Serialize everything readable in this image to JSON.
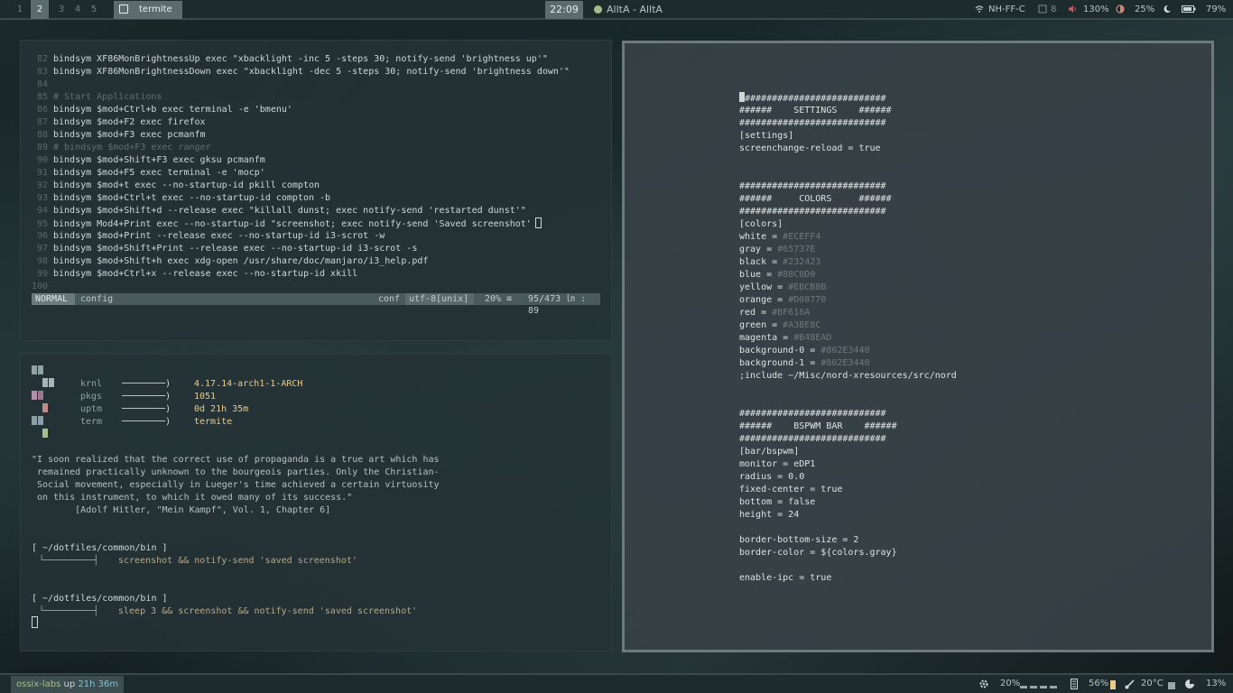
{
  "topbar": {
    "workspaces": [
      "1",
      "2",
      "3",
      "4",
      "5"
    ],
    "active_workspace": "2",
    "window_title": "termite",
    "clock": "22:09",
    "music": "AlltA - AlltA",
    "wifi": "NH-FF-C",
    "disk": "8",
    "volume": "130%",
    "brightness": "25%",
    "night": "",
    "battery": "79%"
  },
  "vim": {
    "lines": [
      {
        "n": "82",
        "t": "bindsym XF86MonBrightnessUp exec \"xbacklight -inc 5 -steps 30; notify-send 'brightness up'\"",
        "kind": "code"
      },
      {
        "n": "83",
        "t": "bindsym XF86MonBrightnessDown exec \"xbacklight -dec 5 -steps 30; notify-send 'brightness down'\"",
        "kind": "code"
      },
      {
        "n": "84",
        "t": "",
        "kind": "code"
      },
      {
        "n": "85",
        "t": "# Start Applications",
        "kind": "comment"
      },
      {
        "n": "86",
        "t": "bindsym $mod+Ctrl+b exec terminal -e 'bmenu'",
        "kind": "code"
      },
      {
        "n": "87",
        "t": "bindsym $mod+F2 exec firefox",
        "kind": "code"
      },
      {
        "n": "88",
        "t": "bindsym $mod+F3 exec pcmanfm",
        "kind": "code"
      },
      {
        "n": "89",
        "t": "# bindsym $mod+F3 exec ranger",
        "kind": "comment"
      },
      {
        "n": "90",
        "t": "bindsym $mod+Shift+F3 exec gksu pcmanfm",
        "kind": "code"
      },
      {
        "n": "91",
        "t": "bindsym $mod+F5 exec terminal -e 'mocp'",
        "kind": "code"
      },
      {
        "n": "92",
        "t": "bindsym $mod+t exec --no-startup-id pkill compton",
        "kind": "code"
      },
      {
        "n": "93",
        "t": "bindsym $mod+Ctrl+t exec --no-startup-id compton -b",
        "kind": "code"
      },
      {
        "n": "94",
        "t": "bindsym $mod+Shift+d --release exec \"killall dunst; exec notify-send 'restarted dunst'\"",
        "kind": "code"
      },
      {
        "n": "95",
        "t": "bindsym Mod4+Print exec --no-startup-id \"screenshot; exec notify-send 'Saved screenshot'",
        "kind": "code"
      },
      {
        "n": "96",
        "t": "bindsym $mod+Print --release exec --no-startup-id i3-scrot -w",
        "kind": "code"
      },
      {
        "n": "97",
        "t": "bindsym $mod+Shift+Print --release exec --no-startup-id i3-scrot -s",
        "kind": "code"
      },
      {
        "n": "98",
        "t": "bindsym $mod+Shift+h exec xdg-open /usr/share/doc/manjaro/i3_help.pdf",
        "kind": "code"
      },
      {
        "n": "99",
        "t": "bindsym $mod+Ctrl+x --release exec --no-startup-id xkill",
        "kind": "code"
      },
      {
        "n": "100",
        "t": "",
        "kind": "code"
      }
    ],
    "status": {
      "mode": "NORMAL",
      "file": "config",
      "filetype": "conf",
      "encoding": "utf-8[unix]",
      "percent": "20% ≡",
      "position": "95/473 ㏑ :  89"
    }
  },
  "neofetch": {
    "rows": [
      {
        "key": "krnl",
        "arrow": "────────)",
        "val": "4.17.14-arch1-1-ARCH"
      },
      {
        "key": "pkgs",
        "arrow": "────────)",
        "val": "1051"
      },
      {
        "key": "uptm",
        "arrow": "────────)",
        "val": "0d 21h 35m"
      },
      {
        "key": "term",
        "arrow": "────────)",
        "val": "termite"
      }
    ],
    "quote": [
      "\"I soon realized that the correct use of propaganda is a true art which has",
      " remained practically unknown to the bourgeois parties. Only the Christian-",
      " Social movement, especially in Lueger's time achieved a certain virtuosity",
      " on this instrument, to which it owed many of its success.\"",
      "        [Adolf Hitler, \"Mein Kampf\", Vol. 1, Chapter 6]"
    ],
    "prompt1_dir": "[ ~/dotfiles/common/bin ]",
    "prompt1_cmd": "screenshot && notify-send 'saved screenshot'",
    "prompt2_dir": "[ ~/dotfiles/common/bin ]",
    "prompt2_cmd": "sleep 3 && screenshot && notify-send 'saved screenshot'",
    "prompt_branch": "└─────────┤"
  },
  "config": {
    "lines": [
      {
        "t": "###########################",
        "dim": ""
      },
      {
        "t": "######    SETTINGS    ######",
        "dim": ""
      },
      {
        "t": "###########################",
        "dim": ""
      },
      {
        "t": "[settings]",
        "dim": ""
      },
      {
        "t": "screenchange-reload = true",
        "dim": ""
      },
      {
        "t": "",
        "dim": ""
      },
      {
        "t": "",
        "dim": ""
      },
      {
        "t": "###########################",
        "dim": ""
      },
      {
        "t": "######     COLORS     ######",
        "dim": ""
      },
      {
        "t": "###########################",
        "dim": ""
      },
      {
        "t": "[colors]",
        "dim": ""
      },
      {
        "t": "white = ",
        "dim": "#ECEFF4"
      },
      {
        "t": "gray = ",
        "dim": "#65737E"
      },
      {
        "t": "black = ",
        "dim": "#232423"
      },
      {
        "t": "blue = ",
        "dim": "#88C0D0"
      },
      {
        "t": "yellow = ",
        "dim": "#EBCB8B"
      },
      {
        "t": "orange = ",
        "dim": "#D08770"
      },
      {
        "t": "red = ",
        "dim": "#BF616A"
      },
      {
        "t": "green = ",
        "dim": "#A3BE8C"
      },
      {
        "t": "magenta = ",
        "dim": "#B48EAD"
      },
      {
        "t": "background-0 = ",
        "dim": "#802E3440"
      },
      {
        "t": "background-1 = ",
        "dim": "#802E3440"
      },
      {
        "t": ";include ~/Misc/nord-xresources/src/nord",
        "dim": ""
      },
      {
        "t": "",
        "dim": ""
      },
      {
        "t": "",
        "dim": ""
      },
      {
        "t": "###########################",
        "dim": ""
      },
      {
        "t": "######    BSPWM BAR    ######",
        "dim": ""
      },
      {
        "t": "###########################",
        "dim": ""
      },
      {
        "t": "[bar/bspwm]",
        "dim": ""
      },
      {
        "t": "monitor = eDP1",
        "dim": ""
      },
      {
        "t": "radius = 0.0",
        "dim": ""
      },
      {
        "t": "fixed-center = true",
        "dim": ""
      },
      {
        "t": "bottom = false",
        "dim": ""
      },
      {
        "t": "height = 24",
        "dim": ""
      },
      {
        "t": "",
        "dim": ""
      },
      {
        "t": "border-bottom-size = 2",
        "dim": ""
      },
      {
        "t": "border-color = ${colors.gray}",
        "dim": ""
      },
      {
        "t": "",
        "dim": ""
      },
      {
        "t": "enable-ipc = true",
        "dim": ""
      }
    ]
  },
  "bottombar": {
    "host": "ossix-labs",
    "uptime_label": "up",
    "uptime": "21h 36m",
    "cpu": "20%",
    "mem": "56%",
    "temp": "20°C",
    "disk": "13%"
  },
  "colors": {
    "accent_green": "#a3be8c",
    "bar_bg": "#1e2b2d",
    "highlight": "#5c6b6d"
  }
}
